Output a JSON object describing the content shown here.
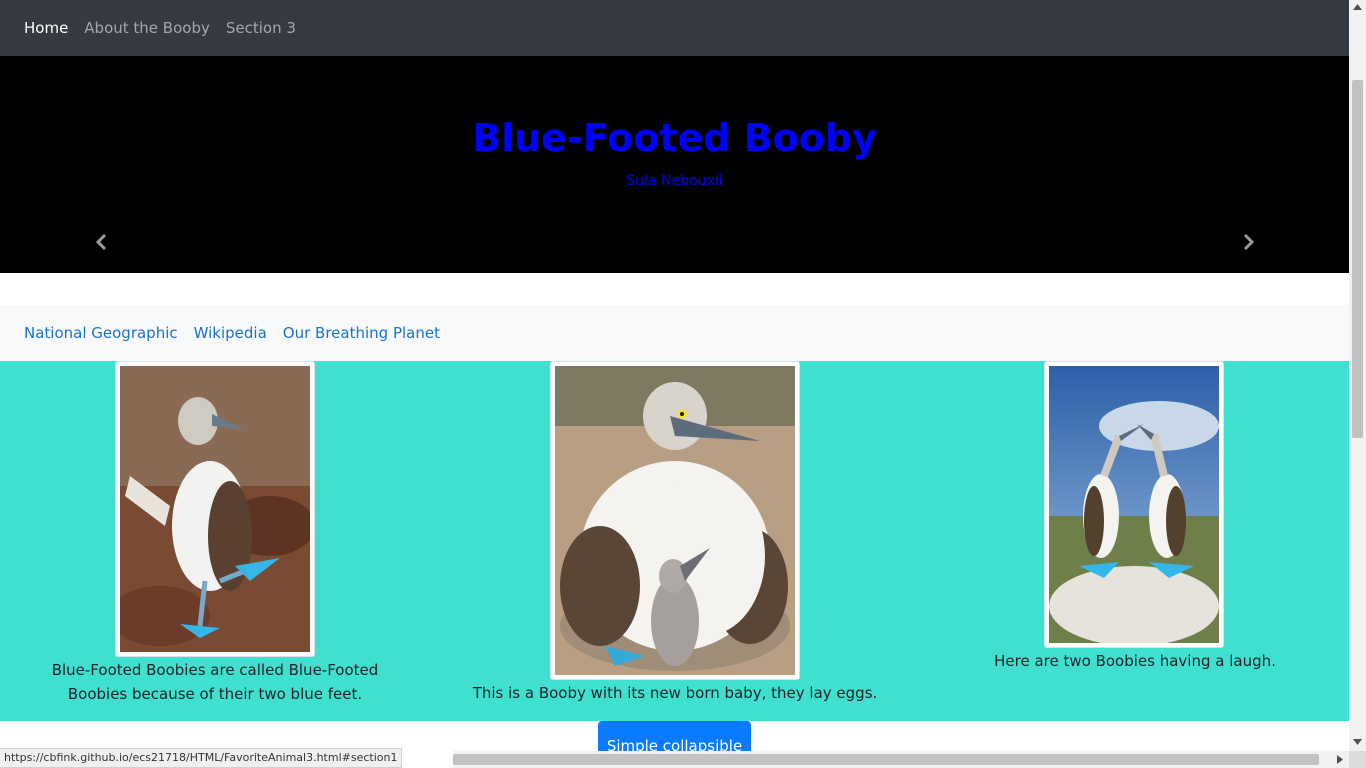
{
  "navbar": {
    "items": [
      {
        "label": "Home"
      },
      {
        "label": "About the Booby"
      },
      {
        "label": "Section 3"
      }
    ]
  },
  "hero": {
    "title": "Blue-Footed Booby",
    "subtitle": "Sula Nebouxii",
    "prev_icon": "chevron-left-icon",
    "next_icon": "chevron-right-icon"
  },
  "links": {
    "items": [
      {
        "label": "National Geographic"
      },
      {
        "label": "Wikipedia"
      },
      {
        "label": "Our Breathing Planet"
      }
    ]
  },
  "gallery": {
    "background": "#40e0d0",
    "photos": [
      {
        "caption": "Blue-Footed Boobies are called Blue-Footed Boobies because of their two blue feet."
      },
      {
        "caption": "This is a Booby with its new born baby, they lay eggs."
      },
      {
        "caption": "Here are two Boobies having a laugh."
      }
    ]
  },
  "collapsible": {
    "label": "Simple collapsible"
  },
  "status_bar": {
    "url": "https://cbfink.github.io/ecs21718/HTML/FavoriteAnimal3.html#section1"
  },
  "colors": {
    "navbar_bg": "#343a40",
    "hero_title": "#0000ff",
    "link": "#1a73c9",
    "button": "#0a7bff"
  }
}
